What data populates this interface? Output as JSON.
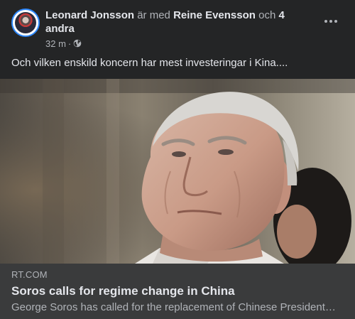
{
  "post": {
    "author": "Leonard Jonsson",
    "with_text": "är med",
    "tagged": "Reine Evensson",
    "and_text": "och",
    "others": "4 andra",
    "trailing_dot": ".",
    "time": "32 m",
    "time_separator": "·",
    "privacy_icon": "globe-icon",
    "more_icon": "more-options-icon",
    "text": "Och vilken enskild koncern har mest investeringar i Kina...."
  },
  "link": {
    "domain": "RT.COM",
    "title": "Soros calls for regime change in China",
    "description": "George Soros has called for the replacement of Chinese President Xi Jinping"
  },
  "colors": {
    "background": "#242526",
    "card": "#3a3b3c",
    "primary_text": "#e4e6eb",
    "secondary_text": "#b0b3b8",
    "avatar_ring": "#2d88ff"
  }
}
